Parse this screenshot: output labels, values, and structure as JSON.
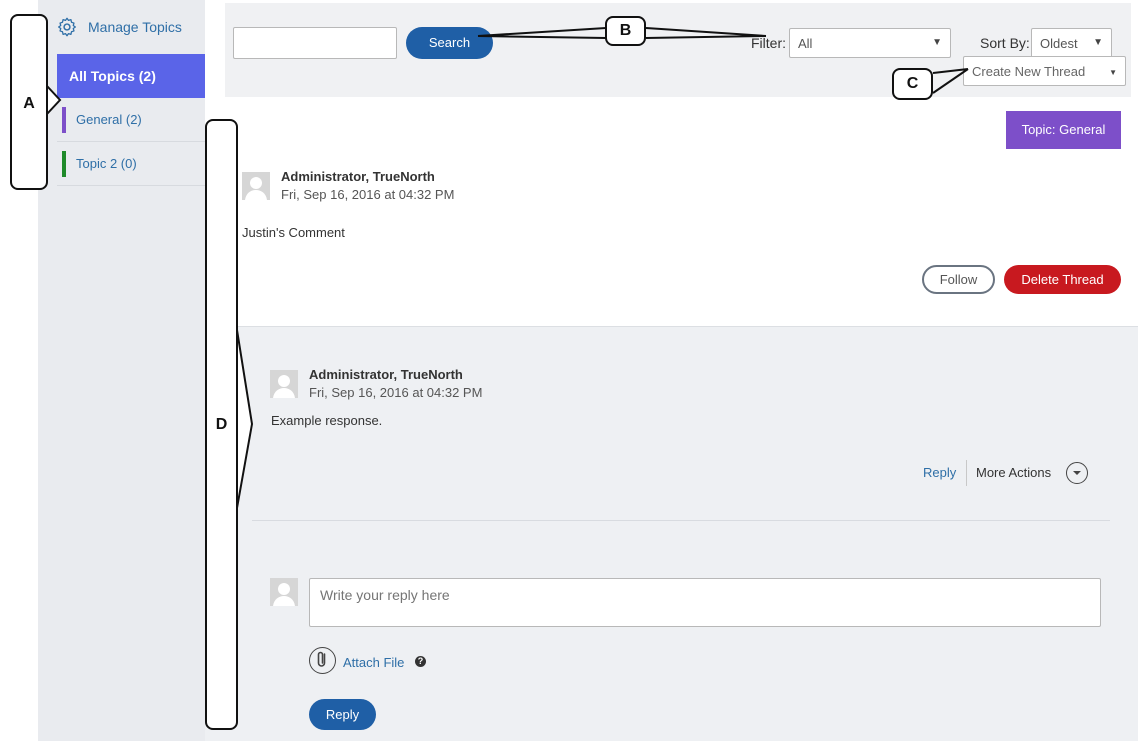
{
  "sidebar": {
    "manage_topics": "Manage Topics",
    "all_topics": "All Topics (2)",
    "items": [
      {
        "label": "General (2)",
        "color": "#7d4fc9"
      },
      {
        "label": "Topic 2 (0)",
        "color": "#1f8a2a"
      }
    ]
  },
  "toolbar": {
    "search_value": "",
    "search_button": "Search",
    "filter_label": "Filter:",
    "filter_value": "All",
    "sort_label": "Sort By:",
    "sort_value": "Oldest",
    "create_thread": "Create New Thread"
  },
  "thread": {
    "topic_badge": "Topic: General",
    "author": "Administrator, TrueNorth",
    "date": "Fri, Sep 16, 2016 at 04:32 PM",
    "body": "Justin's Comment",
    "follow_label": "Follow",
    "delete_label": "Delete Thread"
  },
  "response": {
    "author": "Administrator, TrueNorth",
    "date": "Fri, Sep 16, 2016 at 04:32 PM",
    "body": "Example response.",
    "reply_link": "Reply",
    "more_actions": "More Actions"
  },
  "reply_form": {
    "placeholder": "Write your reply here",
    "attach_label": "Attach File",
    "help_glyph": "?",
    "reply_button": "Reply"
  },
  "annotations": {
    "a": "A",
    "b": "B",
    "c": "C",
    "d": "D"
  },
  "colors": {
    "primary": "#1f5fa6",
    "all_topics_active": "#5a64e8",
    "topic_badge": "#7d4fc9",
    "delete": "#c8191f",
    "link": "#2f6fa7"
  }
}
